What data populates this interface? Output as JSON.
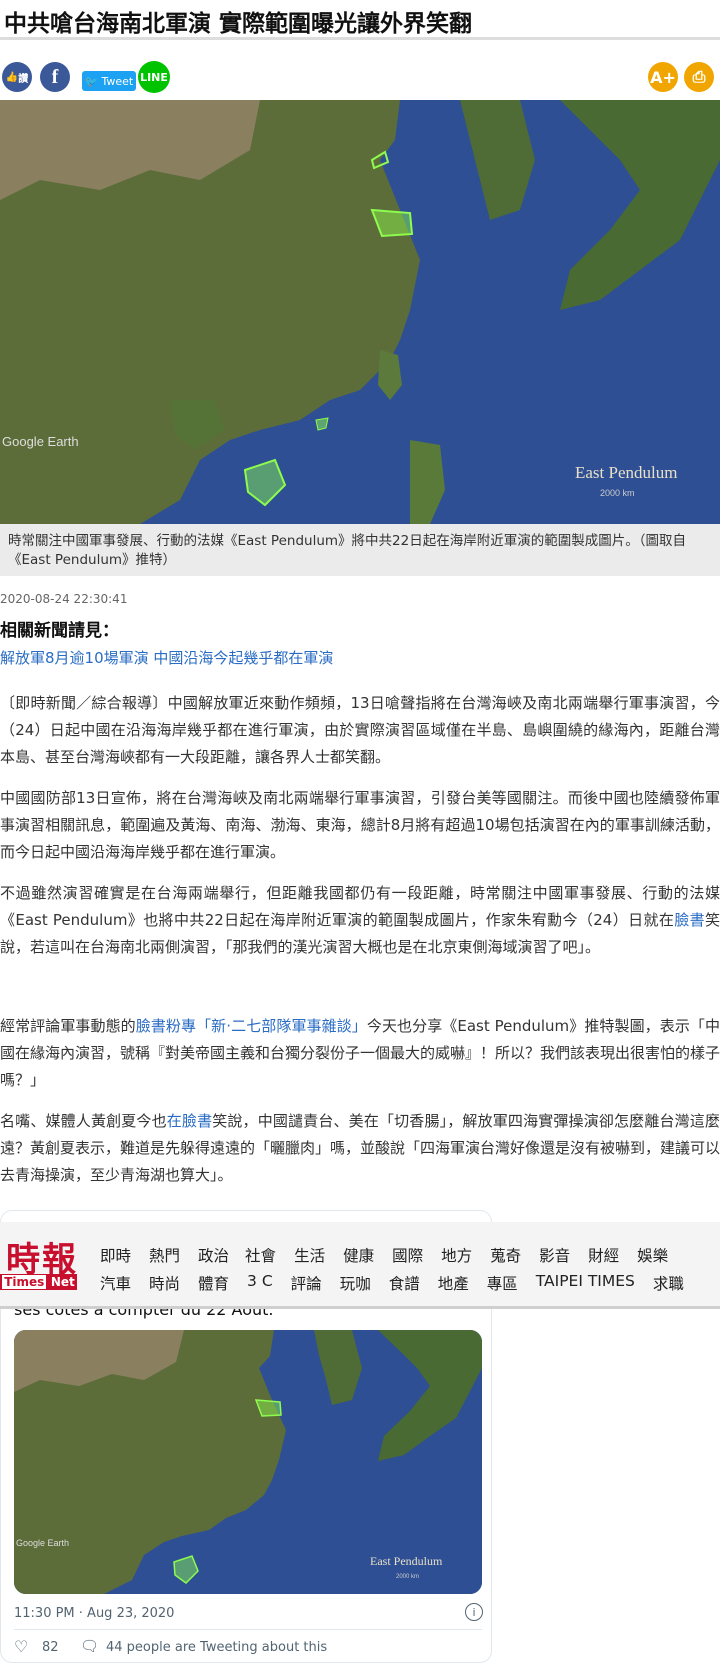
{
  "article": {
    "headline": "中共嗆台海南北軍演 實際範圍曝光讓外界笑翻",
    "caption": "時常關注中國軍事發展、行動的法媒《East Pendulum》將中共22日起在海岸附近軍演的範圍製成圖片。（圖取自《East Pendulum》推特）",
    "timestamp": "2020-08-24 22:30:41",
    "related_title": "相關新聞請見：",
    "related_link": "解放軍8月逾10場軍演 中國沿海今起幾乎都在軍演",
    "para1": "〔即時新聞／綜合報導〕中國解放軍近來動作頻頻，13日嗆聲指將在台灣海峽及南北兩端舉行軍事演習，今（24）日起中國在沿海海岸幾乎都在進行軍演，由於實際演習區域僅在半島、島嶼圍繞的緣海內，距離台灣本島、甚至台灣海峽都有一大段距離，讓各界人士都笑翻。",
    "para2": "中國國防部13日宣佈，將在台灣海峽及南北兩端舉行軍事演習，引發台美等國關注。而後中國也陸續發佈軍事演習相關訊息，範圍遍及黃海、南海、渤海、東海，總計8月將有超過10場包括演習在內的軍事訓練活動，而今日起中國沿海海岸幾乎都在進行軍演。",
    "para3_a": "不過雖然演習確實是在台海兩端舉行，但距離我國都仍有一段距離，時常關注中國軍事發展、行動的法媒《East Pendulum》也將中共22日起在海岸附近軍演的範圍製成圖片，作家朱宥勳今（24）日就在",
    "para3_link": "臉書",
    "para3_b": "笑說，若這叫在台海南北兩側演習，「那我們的漢光演習大概也是在北京東側海域演習了吧」。",
    "para4_a": "經常評論軍事動態的",
    "para4_link": "臉書粉專「新·二七部隊軍事雜談」",
    "para4_b": "今天也分享《East Pendulum》推特製圖，表示「中國在緣海內演習，號稱『對美帝國主義和台獨分裂份子一個最大的威嚇』！所以？我們該表現出很害怕的樣子嗎？」",
    "para5_a": "名嘴、媒體人黃創夏今也",
    "para5_link": "在臉書",
    "para5_b": "笑說，中國譴責台、美在「切香腸」，解放軍四海實彈操演卻怎麼離台灣這麼遠？黃創夏表示，難道是先躲得遠遠的「曬臘肉」嗎，並酸說「四海軍演台灣好像還是沒有被嚇到，建議可以去青海操演，至少青海湖也算大」。"
  },
  "share": {
    "like_label": "讚",
    "fb_label": "f",
    "tweet_label": "Tweet",
    "line_label": "LINE",
    "font_label": "A+",
    "print_label": "⎙"
  },
  "map": {
    "watermark": "East Pendulum",
    "google": "Google Earth",
    "scale": "2000 km"
  },
  "nav": {
    "logo_main": "時報",
    "logo_sub_1": "Times",
    "logo_sub_2": "Net",
    "row1": [
      "即時",
      "熱門",
      "政治",
      "社會",
      "生活",
      "健康",
      "國際",
      "地方",
      "蒐奇",
      "影音",
      "財經",
      "娛樂"
    ],
    "row2": [
      "汽車",
      "時尚",
      "體育",
      "3 C",
      "評論",
      "玩咖",
      "食譜",
      "地產",
      "專區",
      "TAIPEI TIMES",
      "求職"
    ]
  },
  "tweet": {
    "snippet": "ses côtes à compter du 22 Août.",
    "time": "11:30 PM · Aug 23, 2020",
    "likes": "82",
    "tweeting": "44 people are Tweeting about this"
  },
  "colors": {
    "link": "#2a6cc4",
    "brand_red": "#c8102e",
    "share_orange": "#f0a500"
  }
}
